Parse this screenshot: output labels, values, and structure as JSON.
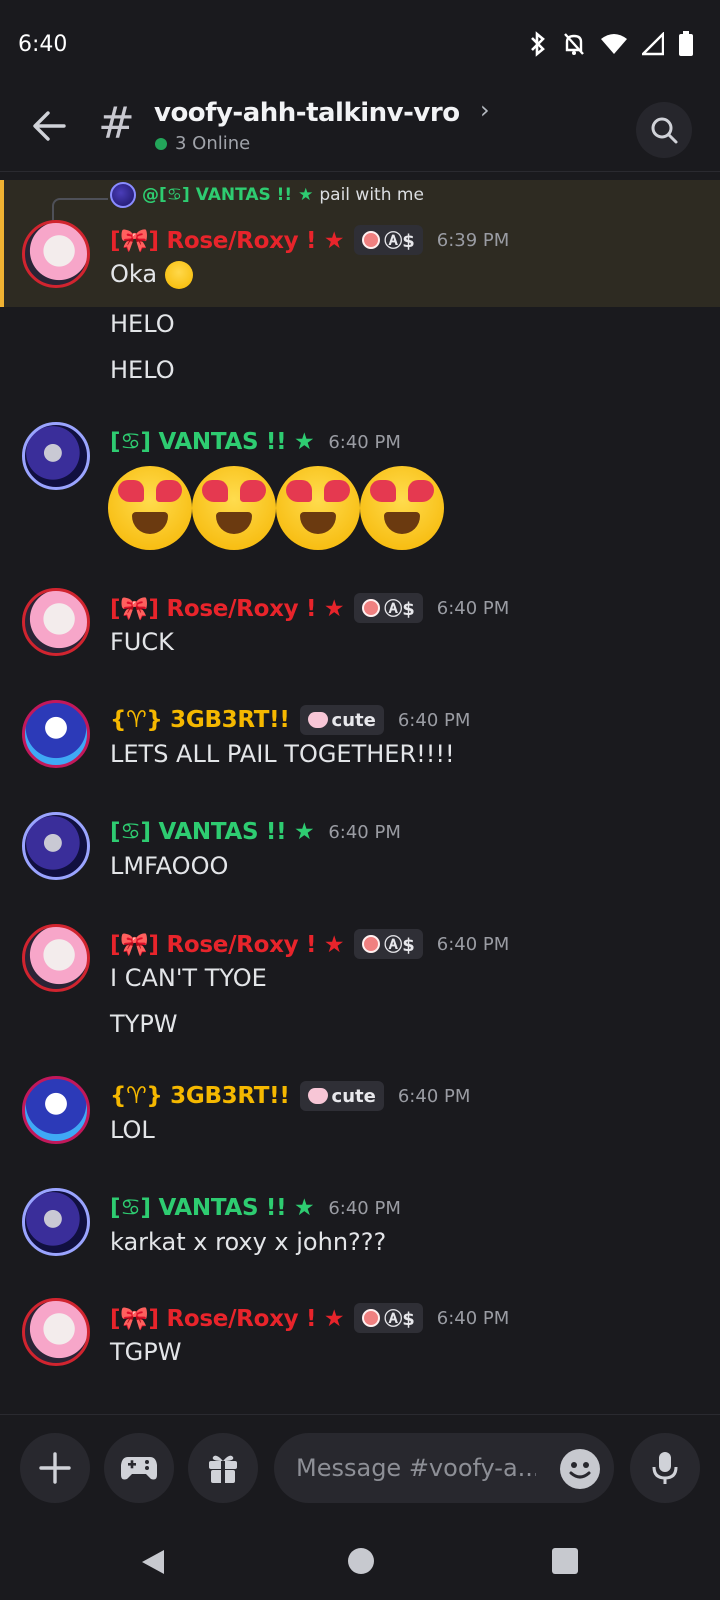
{
  "status_bar": {
    "time": "6:40"
  },
  "header": {
    "channel_name": "voofy-ahh-talkinv-vro",
    "online_text": "3 Online"
  },
  "reply": {
    "author": "@[♋] VANTAS !! ★",
    "text": "pail with me"
  },
  "messages": [
    {
      "author": "[🎀] Rose/Roxy ! ★",
      "tag": "Ⓐ$",
      "time": "6:39 PM",
      "lines": [
        "Oka",
        "HELO",
        "HELO"
      ]
    },
    {
      "author": "[♋] VANTAS !! ★",
      "time": "6:40 PM"
    },
    {
      "author": "[🎀] Rose/Roxy ! ★",
      "tag": "Ⓐ$",
      "time": "6:40 PM",
      "lines": [
        "FUCK"
      ]
    },
    {
      "author": "{♈} 3GB3RT!!",
      "tag": "cute",
      "time": "6:40 PM",
      "lines": [
        "LETS ALL PAIL TOGETHER!!!!"
      ]
    },
    {
      "author": "[♋] VANTAS !! ★",
      "time": "6:40 PM",
      "lines": [
        "LMFAOOO"
      ]
    },
    {
      "author": "[🎀] Rose/Roxy ! ★",
      "tag": "Ⓐ$",
      "time": "6:40 PM",
      "lines": [
        "I CAN'T TYOE",
        "TYPW"
      ]
    },
    {
      "author": "{♈} 3GB3RT!!",
      "tag": "cute",
      "time": "6:40 PM",
      "lines": [
        "LOL"
      ]
    },
    {
      "author": "[♋] VANTAS !! ★",
      "time": "6:40 PM",
      "lines": [
        "karkat x roxy x john???"
      ]
    },
    {
      "author": "[🎀] Rose/Roxy ! ★",
      "tag": "Ⓐ$",
      "time": "6:40 PM",
      "lines": [
        "TGPW"
      ]
    }
  ],
  "composer": {
    "placeholder": "Message #voofy-a..."
  },
  "colors": {
    "rose_name": "#e8242b",
    "vantas_name": "#2ecc71",
    "gb_name": "#f5b800",
    "highlight_bar": "#f0b232",
    "online": "#23a55a"
  }
}
